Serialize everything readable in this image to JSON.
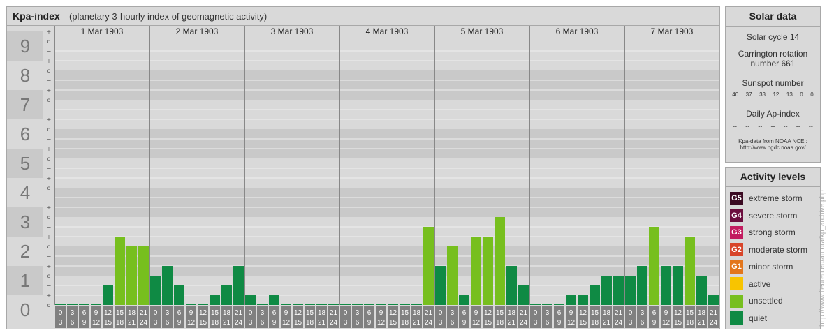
{
  "header": {
    "title": "Kpa-index",
    "subtitle": "(planetary 3-hourly index of geomagnetic activity)"
  },
  "chart_data": {
    "type": "bar",
    "ylim": [
      0,
      9
    ],
    "y_ticks": [
      "0",
      "1",
      "2",
      "3",
      "4",
      "5",
      "6",
      "7",
      "8",
      "9"
    ],
    "y_minor_ticks": [
      "o",
      "+",
      "−"
    ],
    "days": [
      "1 Mar 1903",
      "2 Mar 1903",
      "3 Mar 1903",
      "4 Mar 1903",
      "5 Mar 1903",
      "6 Mar 1903",
      "7 Mar 1903"
    ],
    "hour_start_labels": [
      "0",
      "3",
      "6",
      "9",
      "12",
      "15",
      "18",
      "21"
    ],
    "hour_end_labels": [
      "3",
      "6",
      "9",
      "12",
      "15",
      "18",
      "21",
      "24"
    ],
    "values": [
      [
        0,
        0,
        0,
        0,
        0.667,
        2.333,
        2,
        2
      ],
      [
        1,
        1.333,
        0.667,
        0,
        0,
        0.333,
        0.667,
        1.333
      ],
      [
        0.333,
        0,
        0.333,
        0,
        0,
        0,
        0,
        0
      ],
      [
        0,
        0,
        0,
        0,
        0,
        0,
        0,
        2.667
      ],
      [
        1.333,
        2,
        0.333,
        2.333,
        2.333,
        3,
        1.333,
        0.667
      ],
      [
        0,
        0,
        0,
        0.333,
        0.333,
        0.667,
        1,
        1
      ],
      [
        1,
        1.333,
        2.667,
        1.333,
        1.333,
        2.333,
        1,
        0.333
      ]
    ]
  },
  "colors": {
    "quiet": "#0f8a44",
    "unsettled": "#77bf1e",
    "active": "#f8c400",
    "minor": "#e3761c",
    "moderate": "#d8452a",
    "strong": "#c21b5f",
    "severe": "#6c0e3e",
    "extreme": "#3b0a22"
  },
  "solar": {
    "title": "Solar data",
    "cycle": "Solar cycle 14",
    "carrington_line1": "Carrington rotation",
    "carrington_line2": "number 661",
    "sunspot_label": "Sunspot number",
    "sunspots": [
      "40",
      "37",
      "33",
      "12",
      "13",
      "0",
      "0"
    ],
    "ap_label": "Daily Ap-index",
    "ap_values": [
      "--",
      "--",
      "--",
      "--",
      "--",
      "--",
      "--"
    ],
    "source_line1": "Kpa-data from NOAA NCEI:",
    "source_line2": "http://www.ngdc.noaa.gov/"
  },
  "activity": {
    "title": "Activity levels",
    "levels": [
      {
        "code": "G5",
        "label": "extreme storm",
        "color": "#3b0a22"
      },
      {
        "code": "G4",
        "label": "severe storm",
        "color": "#6c0e3e"
      },
      {
        "code": "G3",
        "label": "strong storm",
        "color": "#c21b5f"
      },
      {
        "code": "G2",
        "label": "moderate storm",
        "color": "#d8452a"
      },
      {
        "code": "G1",
        "label": "minor storm",
        "color": "#e3761c"
      },
      {
        "code": "",
        "label": "active",
        "color": "#f8c400"
      },
      {
        "code": "",
        "label": "unsettled",
        "color": "#77bf1e"
      },
      {
        "code": "",
        "label": "quiet",
        "color": "#0f8a44"
      }
    ]
  },
  "watermark": "http://www.fleuren.eu/aurora/kp_archive.php"
}
